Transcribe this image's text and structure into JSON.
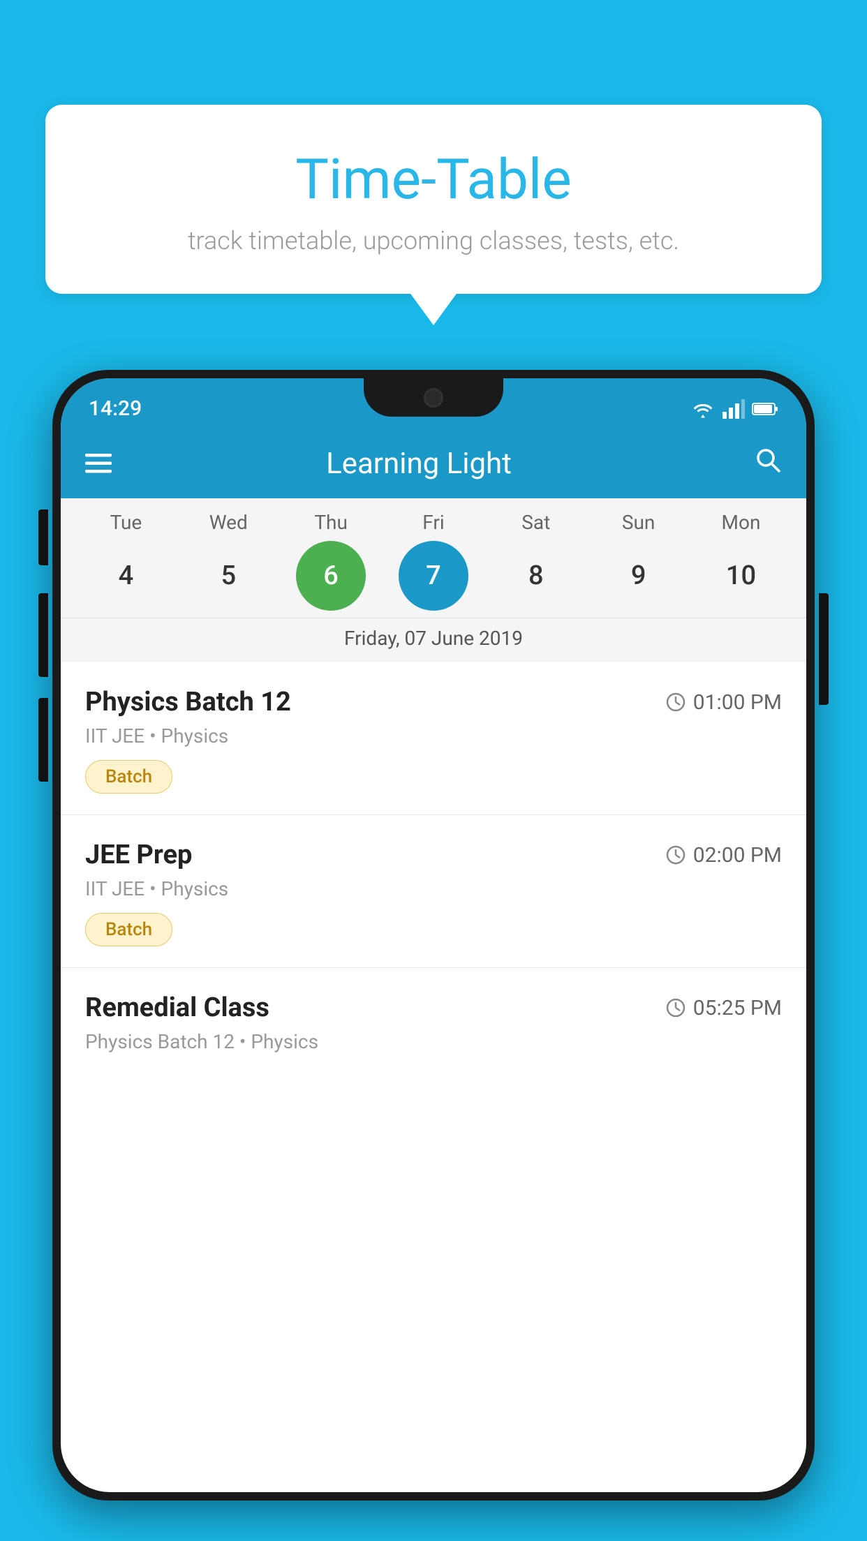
{
  "background_color": "#1ab8e8",
  "speech_bubble": {
    "title": "Time-Table",
    "subtitle": "track timetable, upcoming classes, tests, etc."
  },
  "phone": {
    "status_bar": {
      "time": "14:29"
    },
    "header": {
      "app_name": "Learning Light",
      "menu_icon": "☰",
      "search_icon": "🔍"
    },
    "calendar": {
      "day_names": [
        "Tue",
        "Wed",
        "Thu",
        "Fri",
        "Sat",
        "Sun",
        "Mon"
      ],
      "day_numbers": [
        4,
        5,
        6,
        7,
        8,
        9,
        10
      ],
      "today_index": 2,
      "selected_index": 3,
      "selected_date_label": "Friday, 07 June 2019"
    },
    "schedule": [
      {
        "title": "Physics Batch 12",
        "time": "01:00 PM",
        "meta": "IIT JEE • Physics",
        "badge": "Batch"
      },
      {
        "title": "JEE Prep",
        "time": "02:00 PM",
        "meta": "IIT JEE • Physics",
        "badge": "Batch"
      },
      {
        "title": "Remedial Class",
        "time": "05:25 PM",
        "meta": "Physics Batch 12 • Physics",
        "badge": null
      }
    ]
  }
}
